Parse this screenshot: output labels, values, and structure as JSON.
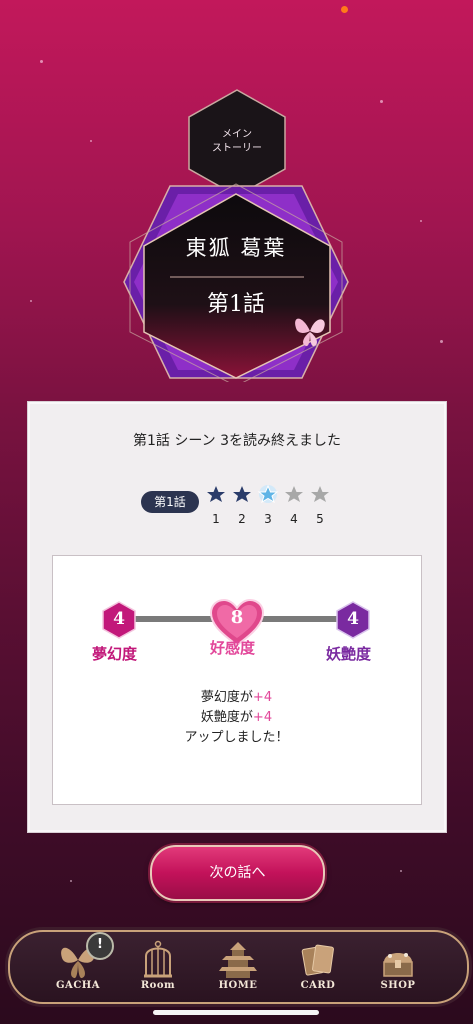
{
  "header": {
    "category_line1": "メイン",
    "category_line2": "ストーリー",
    "character_name": "東狐 葛葉",
    "chapter": "第1話"
  },
  "result": {
    "message": "第1話 シーン 3を読み終えました",
    "episode_badge": "第1話",
    "scenes": [
      "1",
      "2",
      "3",
      "4",
      "5"
    ],
    "scenes_completed": 3
  },
  "stats": {
    "dream": {
      "value": "4",
      "label": "夢幻度"
    },
    "affection": {
      "value": "8",
      "label": "好感度"
    },
    "allure": {
      "value": "4",
      "label": "妖艶度"
    },
    "line1_prefix": "夢幻度が",
    "line1_plus": "+4",
    "line2_prefix": "妖艶度が",
    "line2_plus": "+4",
    "line3": "アップしました！"
  },
  "next_button": "次の話へ",
  "nav": {
    "gacha": "GACHA",
    "room": "Room",
    "home": "HOME",
    "card": "CARD",
    "shop": "SHOP",
    "gacha_badge": "!"
  },
  "colors": {
    "accent": "#c3125a",
    "dream": "#c2187a",
    "allure": "#7a2aa0",
    "plus": "#e2479a"
  }
}
